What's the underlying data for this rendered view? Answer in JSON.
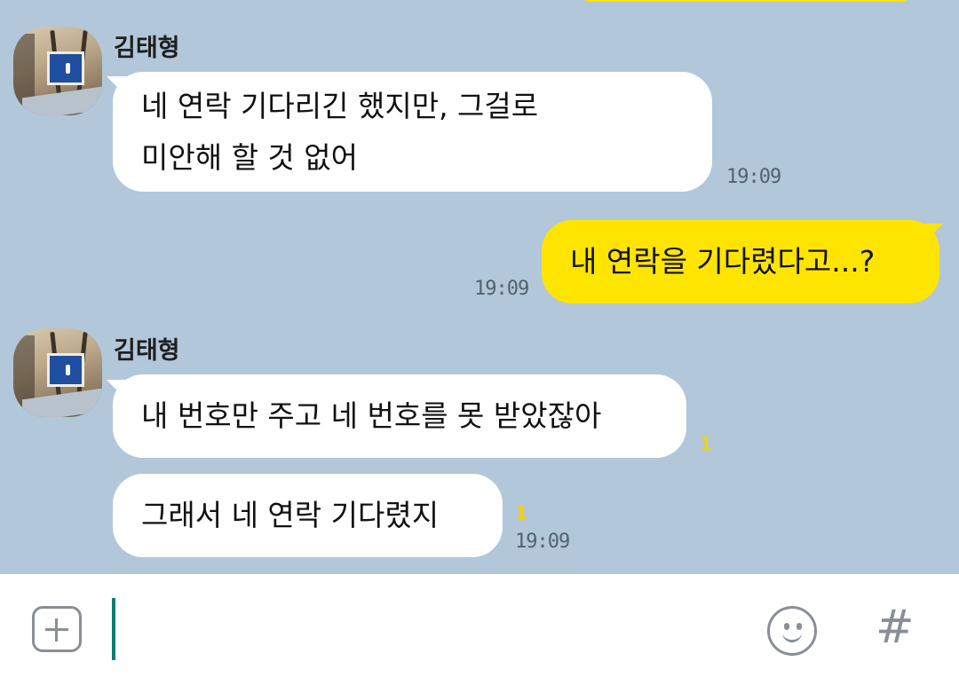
{
  "chat": {
    "messages": [
      {
        "sender": "김태형",
        "lines": [
          "네 연락 기다리긴 했지만, 그걸로",
          "미안해 할 것 없어"
        ],
        "time": "19:09"
      },
      {
        "sender": "me",
        "text": "내 연락을 기다렸다고...?",
        "time": "19:09"
      },
      {
        "sender": "김태형",
        "text": "내 번호만 주고 네 번호를 못 받았잖아",
        "unread": "1"
      },
      {
        "sender": "김태형",
        "text": "그래서 네 연락 기다렸지",
        "unread": "1",
        "time": "19:09"
      }
    ]
  },
  "input": {
    "plus_icon": "plus-icon",
    "emoji_icon": "emoji-icon",
    "hash_label": "#"
  },
  "colors": {
    "background": "#b2c7da",
    "my_bubble": "#fee500",
    "their_bubble": "#ffffff",
    "cursor": "#0f7c6f"
  }
}
